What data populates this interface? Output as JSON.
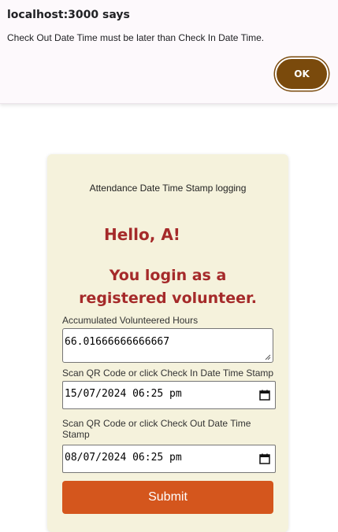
{
  "dialog": {
    "title": "localhost:3000 says",
    "message": "Check Out Date Time must be later than Check In Date Time.",
    "ok_label": "OK",
    "ok_color": "#7a4a0c"
  },
  "card": {
    "subtitle": "Attendance Date Time Stamp logging",
    "greeting": "Hello, A!",
    "role_line_1": "You login as a",
    "role_line_2": "registered volunteer.",
    "accent_color": "#a52a2a",
    "background_color": "#f5f2dc"
  },
  "form": {
    "hours_label": "Accumulated Volunteered Hours",
    "hours_value": "66.01666666666667",
    "checkin_label": "Scan QR Code or click Check In Date Time Stamp",
    "checkin_value": "15/07/2024 06:25 pm",
    "checkout_label": "Scan QR Code or click Check Out Date Time Stamp",
    "checkout_value": "08/07/2024 06:25 pm",
    "submit_label": "Submit",
    "submit_color": "#d4561d",
    "icons": {
      "resize": "resize-grip-icon",
      "calendar": "calendar-icon"
    }
  }
}
